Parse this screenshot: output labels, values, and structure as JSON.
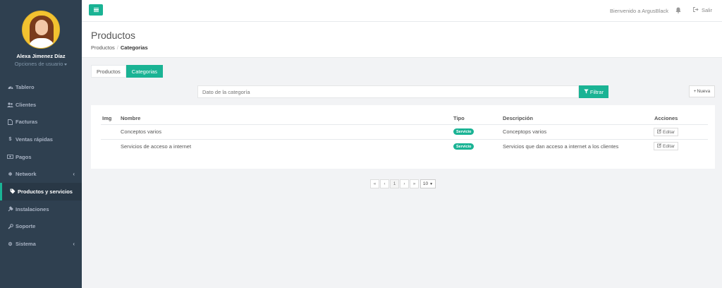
{
  "user": {
    "name": "Alexa Jimenez Díaz",
    "options_label": "Opciones de usuario"
  },
  "sidebar": {
    "items": [
      {
        "label": "Tablero",
        "icon": "dashboard-icon"
      },
      {
        "label": "Clientes",
        "icon": "users-icon"
      },
      {
        "label": "Facturas",
        "icon": "file-icon"
      },
      {
        "label": "Ventas rápidas",
        "icon": "dollar-icon"
      },
      {
        "label": "Pagos",
        "icon": "money-icon"
      },
      {
        "label": "Network",
        "icon": "network-icon",
        "has_submenu": true
      },
      {
        "label": "Productos y servicios",
        "icon": "tags-icon",
        "active": true
      },
      {
        "label": "Instalaciones",
        "icon": "install-icon"
      },
      {
        "label": "Soporte",
        "icon": "wrench-icon"
      },
      {
        "label": "Sistema",
        "icon": "cogs-icon",
        "has_submenu": true
      }
    ]
  },
  "topbar": {
    "welcome": "Bienvenido a ArgusBlack",
    "logout": "Salir"
  },
  "page": {
    "title": "Productos",
    "breadcrumb": [
      "Productos",
      "Categorias"
    ]
  },
  "tabs": [
    "Productos",
    "Categorias"
  ],
  "search": {
    "placeholder": "Dato de la categoría",
    "button": "Filtrar"
  },
  "new_button": "Nueva",
  "table": {
    "headers": [
      "Img",
      "Nombre",
      "Tipo",
      "Descripción",
      "Acciones"
    ],
    "rows": [
      {
        "img": "",
        "nombre": "Conceptos varios",
        "tipo": "Servicio",
        "descripcion": "Conceptops varios",
        "accion": "Editar"
      },
      {
        "img": "",
        "nombre": "Servicios de acceso a internet",
        "tipo": "Servicio",
        "descripcion": "Servicios que dan acceso a internet a los clientes",
        "accion": "Editar"
      }
    ]
  },
  "pagination": {
    "first": "«",
    "prev": "‹",
    "current": "1",
    "next": "›",
    "last": "»",
    "page_size": "10"
  },
  "colors": {
    "accent": "#1ab394",
    "sidebar": "#2f4050"
  }
}
